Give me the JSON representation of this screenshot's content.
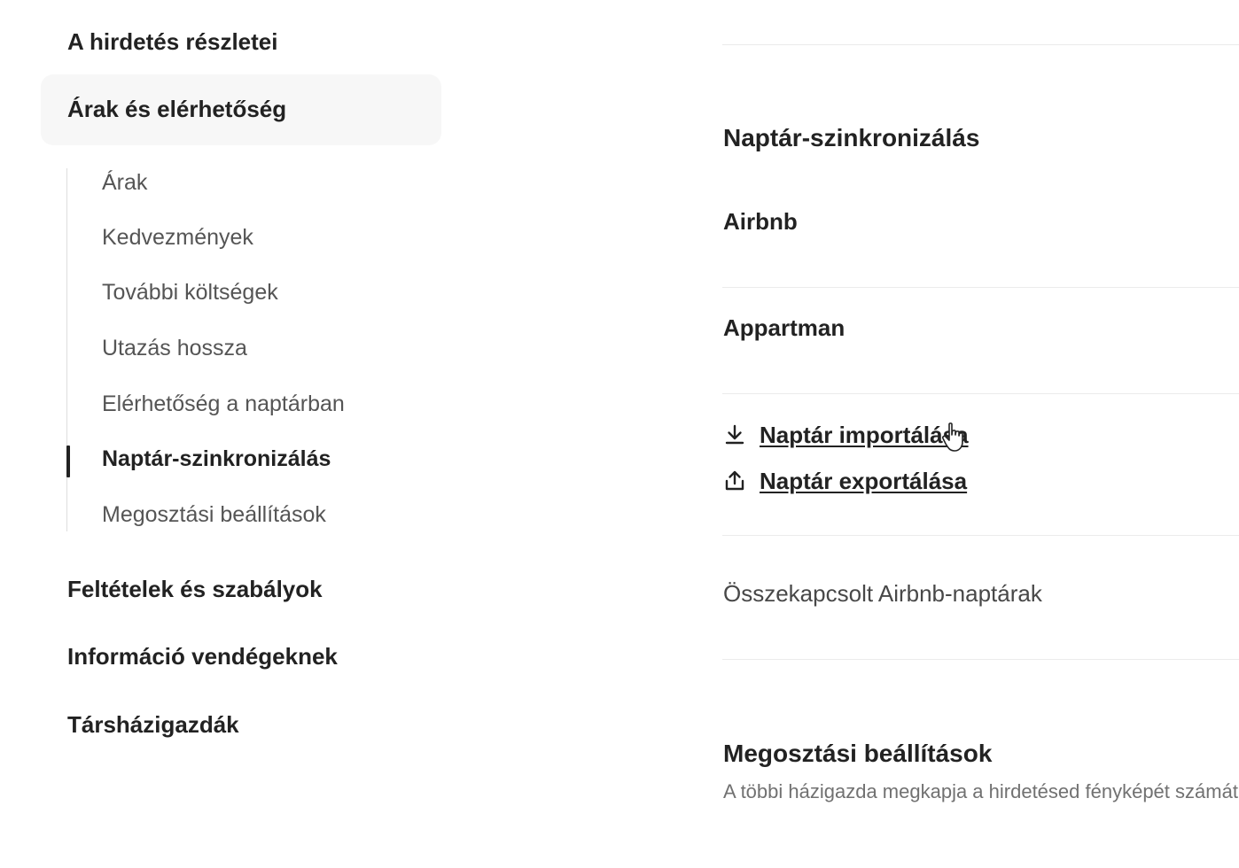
{
  "sidebar": {
    "listing_details": "A hirdetés részletei",
    "pricing_availability": "Árak és elérhetőség",
    "sub_items": [
      {
        "label": "Árak"
      },
      {
        "label": "Kedvezmények"
      },
      {
        "label": "További költségek"
      },
      {
        "label": "Utazás hossza"
      },
      {
        "label": "Elérhetőség a naptárban"
      },
      {
        "label": "Naptár-szinkronizálás"
      },
      {
        "label": "Megosztási beállítások"
      }
    ],
    "active_sub_item": "Naptár-szinkronizálás",
    "terms_rules": "Feltételek és szabályok",
    "guest_info": "Információ vendégeknek",
    "cohosts": "Társházigazdák"
  },
  "main": {
    "calendar_sync": {
      "heading": "Naptár-szinkronizálás",
      "rows": [
        "Airbnb",
        "Appartman"
      ],
      "import_link": "Naptár importálása",
      "export_link": "Naptár exportálása",
      "connected_calendars": "Összekapcsolt Airbnb-naptárak"
    },
    "sharing": {
      "heading": "Megosztási beállítások",
      "description": "A többi házigazda megkapja a hirdetésed fényképét számát."
    }
  },
  "icons": {
    "import": "download-icon",
    "export": "upload-icon",
    "cursor": "hand-pointer-cursor"
  },
  "colors": {
    "text_primary": "#222222",
    "text_secondary": "#717171",
    "active_bg": "#f7f7f7",
    "divider": "#ebebeb"
  }
}
